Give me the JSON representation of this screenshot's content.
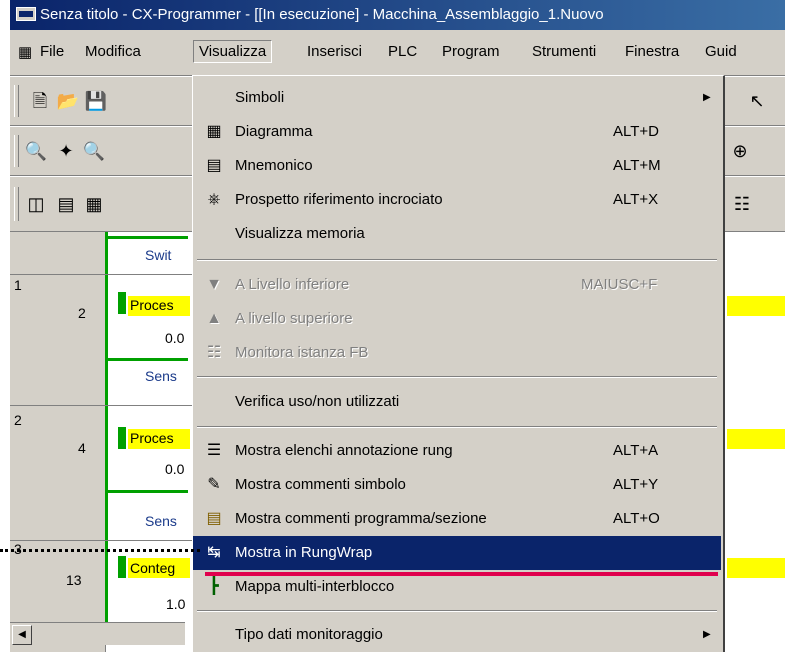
{
  "window": {
    "title": "Senza titolo - CX-Programmer - [[In esecuzione] - Macchina_Assemblaggio_1.Nuovo"
  },
  "menubar": {
    "items": [
      "File",
      "Modifica",
      "Visualizza",
      "Inserisci",
      "PLC",
      "Program",
      "Strumenti",
      "Finestra",
      "Guid"
    ]
  },
  "ladder": {
    "header_text": "Swit",
    "rows": [
      {
        "section": "1",
        "step": "2",
        "box": "Proces",
        "addr": "0.0",
        "sensor": "Sens"
      },
      {
        "section": "2",
        "step": "4",
        "box": "Proces",
        "addr": "0.0",
        "sensor": "Sens"
      },
      {
        "section": "3",
        "step": "13",
        "box": "Conteg",
        "addr": "1.0",
        "sensor": ""
      }
    ]
  },
  "menu": {
    "items": [
      {
        "label": "Simboli",
        "shortcut": "",
        "icon": "",
        "submenu": true,
        "disabled": false
      },
      {
        "label": "Diagramma",
        "shortcut": "ALT+D",
        "icon": "diagram-icon",
        "disabled": false
      },
      {
        "label": "Mnemonico",
        "shortcut": "ALT+M",
        "icon": "mnemonic-icon",
        "disabled": false
      },
      {
        "label": "Prospetto riferimento incrociato",
        "shortcut": "ALT+X",
        "icon": "cross-reference-icon",
        "disabled": false
      },
      {
        "label": "Visualizza memoria",
        "shortcut": "",
        "icon": "",
        "disabled": false
      },
      {
        "label": "A Livello inferiore",
        "shortcut": "MAIUSC+F",
        "icon": "level-down-icon",
        "disabled": true
      },
      {
        "label": "A livello superiore",
        "shortcut": "",
        "icon": "level-up-icon",
        "disabled": true
      },
      {
        "label": "Monitora istanza FB",
        "shortcut": "",
        "icon": "fb-monitor-icon",
        "disabled": true
      },
      {
        "label": "Verifica uso/non utilizzati",
        "shortcut": "",
        "icon": "",
        "disabled": false
      },
      {
        "label": "Mostra elenchi annotazione rung",
        "shortcut": "ALT+A",
        "icon": "annotation-list-icon",
        "disabled": false
      },
      {
        "label": "Mostra commenti simbolo",
        "shortcut": "ALT+Y",
        "icon": "symbol-comment-icon",
        "disabled": false
      },
      {
        "label": "Mostra commenti programma/sezione",
        "shortcut": "ALT+O",
        "icon": "program-comment-icon",
        "disabled": false
      },
      {
        "label": "Mostra in RungWrap",
        "shortcut": "",
        "icon": "rungwrap-icon",
        "disabled": false,
        "selected": true
      },
      {
        "label": "Mappa multi-interblocco",
        "shortcut": "",
        "icon": "interlock-map-icon",
        "disabled": false
      },
      {
        "label": "Tipo dati monitoraggio",
        "shortcut": "",
        "icon": "",
        "submenu": true,
        "disabled": false
      }
    ]
  },
  "colors": {
    "selection": "#0a246a",
    "highlight_line": "#e0004d",
    "rung_box": "#ffff00",
    "rail": "#00a000"
  }
}
